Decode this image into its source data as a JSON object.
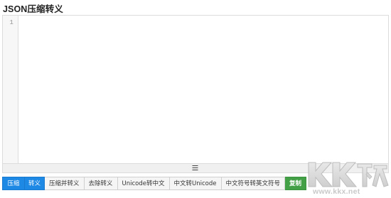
{
  "page": {
    "title": "JSON压缩转义"
  },
  "editor": {
    "line_numbers": [
      "1"
    ],
    "content": ""
  },
  "toolbar": {
    "compress_label": "压缩",
    "escape_label": "转义",
    "compress_and_escape_label": "压缩并转义",
    "unescape_label": "去除转义",
    "unicode_to_chinese_label": "Unicode转中文",
    "chinese_to_unicode_label": "中文转Unicode",
    "cn_punct_to_en_punct_label": "中文符号转英文符号",
    "copy_label": "复制"
  },
  "watermark": {
    "logo_text": "KK下载",
    "url": "www.kkx.net"
  },
  "colors": {
    "primary_button": "#1e88e5",
    "copy_button": "#43a047",
    "secondary_button": "#f5f5f5",
    "gutter": "#f7f7f7",
    "border": "#dcdcdc"
  },
  "icons": {
    "resize_handle": "hamburger-grip-icon"
  }
}
